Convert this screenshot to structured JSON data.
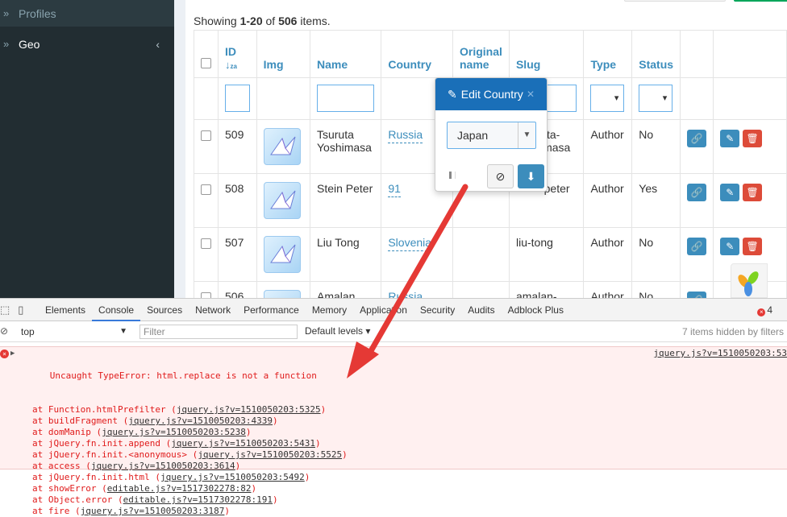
{
  "sidebar": {
    "items": [
      {
        "label": "Profiles"
      },
      {
        "label": "Geo"
      }
    ]
  },
  "summary": {
    "prefix": "Showing ",
    "range": "1-20",
    "of": " of ",
    "total": "506",
    "suffix": " items."
  },
  "table": {
    "headers": {
      "id": "ID",
      "img": "Img",
      "name": "Name",
      "country": "Country",
      "original_name_1": "Original",
      "original_name_2": "name",
      "slug": "Slug",
      "type": "Type",
      "status": "Status"
    },
    "rows": [
      {
        "id": "509",
        "name_1": "Tsuruta",
        "name_2": "Yoshimasa",
        "country": "Russia",
        "slug_1": "ta-",
        "slug_2": "imasa",
        "type": "Author",
        "status": "No"
      },
      {
        "id": "508",
        "name_1": "Stein Peter",
        "name_2": "",
        "country": "91",
        "slug_1": "-peter",
        "slug_2": "",
        "type": "Author",
        "status": "Yes"
      },
      {
        "id": "507",
        "name_1": "Liu Tong",
        "name_2": "",
        "country": "Slovenia",
        "slug_1": "liu-tong",
        "slug_2": "",
        "type": "Author",
        "status": "No"
      },
      {
        "id": "506",
        "name_1": "Amalan",
        "name_2": "",
        "country": "Russia",
        "slug_1": "amalan-",
        "slug_2": "",
        "type": "Author",
        "status": "No"
      }
    ]
  },
  "popover": {
    "title": "Edit Country",
    "selected": "Japan"
  },
  "devtools": {
    "tabs": [
      "Elements",
      "Console",
      "Sources",
      "Network",
      "Performance",
      "Memory",
      "Application",
      "Security",
      "Audits",
      "Adblock Plus"
    ],
    "error_count": "4",
    "context": "top",
    "filter_placeholder": "Filter",
    "levels": "Default levels ▾",
    "hidden_note": "7 items hidden by filters",
    "error": {
      "head": "Uncaught TypeError: html.replace is not a function",
      "head_src": "jquery.js?v=1510050203:53",
      "stack": [
        {
          "text": "at Function.htmlPrefilter (",
          "link": "jquery.js?v=1510050203:5325",
          "end": ")"
        },
        {
          "text": "at buildFragment (",
          "link": "jquery.js?v=1510050203:4339",
          "end": ")"
        },
        {
          "text": "at domManip (",
          "link": "jquery.js?v=1510050203:5238",
          "end": ")"
        },
        {
          "text": "at jQuery.fn.init.append (",
          "link": "jquery.js?v=1510050203:5431",
          "end": ")"
        },
        {
          "text": "at jQuery.fn.init.<anonymous> (",
          "link": "jquery.js?v=1510050203:5525",
          "end": ")"
        },
        {
          "text": "at access (",
          "link": "jquery.js?v=1510050203:3614",
          "end": ")"
        },
        {
          "text": "at jQuery.fn.init.html (",
          "link": "jquery.js?v=1510050203:5492",
          "end": ")"
        },
        {
          "text": "at showError (",
          "link": "editable.js?v=1517302278:82",
          "end": ")"
        },
        {
          "text": "at Object.error (",
          "link": "editable.js?v=1517302278:191",
          "end": ")"
        },
        {
          "text": "at fire (",
          "link": "jquery.js?v=1510050203:3187",
          "end": ")"
        }
      ]
    }
  },
  "colors": {
    "accent": "#3c8dbc",
    "danger": "#dd4b39",
    "popover_header": "#1a6fb8",
    "arrow": "#e53935"
  }
}
